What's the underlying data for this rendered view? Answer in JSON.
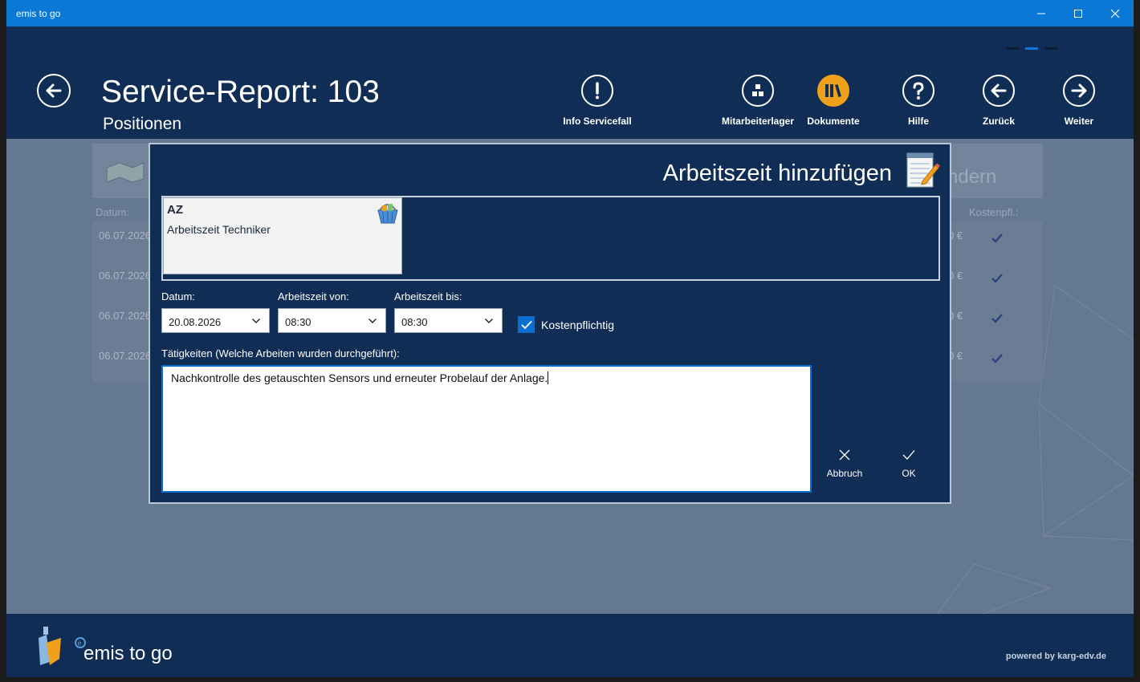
{
  "window": {
    "title": "emis to go"
  },
  "header": {
    "title": "Service-Report: 103",
    "subtitle": "Positionen",
    "toolbar": [
      {
        "label": "Info Servicefall",
        "icon": "exclamation-icon"
      },
      {
        "label": "Mitarbeiterlager",
        "icon": "warehouse-icon"
      },
      {
        "label": "Dokumente",
        "icon": "books-icon"
      },
      {
        "label": "Hilfe",
        "icon": "question-icon"
      },
      {
        "label": "Zurück",
        "icon": "arrow-left-icon"
      },
      {
        "label": "Weiter",
        "icon": "arrow-right-icon"
      }
    ]
  },
  "background": {
    "bar_text": "ndern",
    "col_date": "Datum:",
    "col_cost": "Kostenpfl.:",
    "rows": [
      {
        "date": "06.07.2026",
        "amount": "0 €"
      },
      {
        "date": "06.07.2026",
        "amount": "0 €"
      },
      {
        "date": "06.07.2026",
        "amount": "0 €"
      },
      {
        "date": "06.07.2026",
        "amount": "0 €"
      }
    ]
  },
  "dialog": {
    "title": "Arbeitszeit hinzufügen",
    "item": {
      "code": "AZ",
      "name": "Arbeitszeit Techniker"
    },
    "fields": {
      "date_label": "Datum:",
      "date_value": "20.08.2026",
      "from_label": "Arbeitszeit von:",
      "from_value": "08:30",
      "to_label": "Arbeitszeit bis:",
      "to_value": "08:30",
      "billable_label": "Kostenpflichtig"
    },
    "activities_label": "Tätigkeiten (Welche Arbeiten wurden durchgeführt):",
    "activities_value": "Nachkontrolle des getauschten Sensors und erneuter Probelauf der Anlage.",
    "cancel_label": "Abbruch",
    "ok_label": "OK"
  },
  "footer": {
    "brand": "emis to go",
    "powered": "powered by karg-edv.de"
  },
  "colors": {
    "titlebar": "#0a78d4",
    "navy": "#0f2d55",
    "accent": "#f0a11b",
    "overlay": "#647891"
  }
}
